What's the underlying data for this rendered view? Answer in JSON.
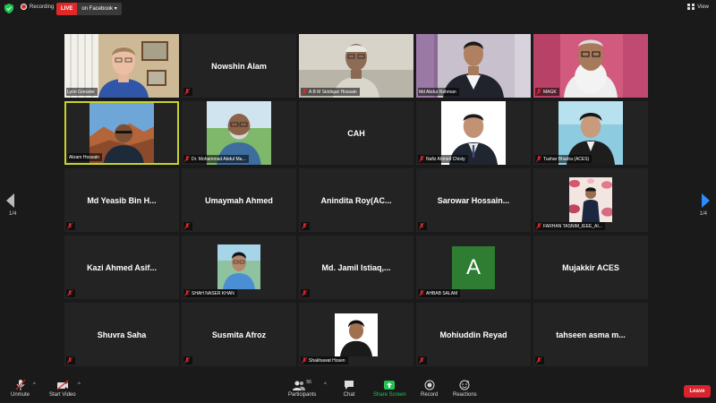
{
  "topbar": {
    "recording_label": "Recording",
    "live_label": "LIVE",
    "live_destination": "on Facebook",
    "view_label": "View"
  },
  "tiles": [
    {
      "name": "Lynn Gressler",
      "label": "Lynn Gressler",
      "show_name": false
    },
    {
      "name": "Nowshin Alam",
      "label": "",
      "show_name": true
    },
    {
      "name": "A B M Siddique Hossain",
      "label": "A B M Siddique Hossain",
      "show_name": false
    },
    {
      "name": "Md Abdur Rahman",
      "label": "Md Abdur Rahman",
      "show_name": false
    },
    {
      "name": "MAGK",
      "label": "MAGK",
      "show_name": false
    },
    {
      "name": "Akram Hossain",
      "label": "Akram Hossain",
      "show_name": false
    },
    {
      "name": "Dr. Mohammad Abdul Ma...",
      "label": "Dr. Mohammad Abdul Ma...",
      "show_name": false
    },
    {
      "name": "CAH",
      "label": "",
      "show_name": true
    },
    {
      "name": "Nafiz Ahmed Chisty",
      "label": "Nafiz Ahmed Chisty",
      "show_name": false
    },
    {
      "name": "Tushar Bhadra (ACES)",
      "label": "Tushar Bhadra (ACES)",
      "show_name": false
    },
    {
      "name": "Md Yeasib Bin H...",
      "label": "",
      "show_name": true
    },
    {
      "name": "Umaymah Ahmed",
      "label": "",
      "show_name": true
    },
    {
      "name": "Anindita Roy(AC...",
      "label": "",
      "show_name": true
    },
    {
      "name": "Sarowar Hossain...",
      "label": "",
      "show_name": true
    },
    {
      "name": "FARHAN TASNIM_IEEE_AI...",
      "label": "FARHAN TASNIM_IEEE_AI...",
      "show_name": false
    },
    {
      "name": "Kazi Ahmed Asif...",
      "label": "",
      "show_name": true
    },
    {
      "name": "SHAH NASER KHAN",
      "label": "SHAH NASER KHAN",
      "show_name": false
    },
    {
      "name": "Md. Jamil Istiaq,...",
      "label": "",
      "show_name": true
    },
    {
      "name": "AHBAB SALAM",
      "label": "AHBAB SALAM",
      "show_name": false,
      "avatar_letter": "A"
    },
    {
      "name": "Mujakkir ACES",
      "label": "",
      "show_name": true
    },
    {
      "name": "Shuvra Saha",
      "label": "",
      "show_name": true
    },
    {
      "name": "Susmita Afroz",
      "label": "",
      "show_name": true
    },
    {
      "name": "Shakhawat Hosen",
      "label": "Shakhawat Hosen",
      "show_name": false
    },
    {
      "name": "Mohiuddin Reyad",
      "label": "",
      "show_name": true
    },
    {
      "name": "tahseen asma m...",
      "label": "",
      "show_name": true
    }
  ],
  "pagination": {
    "left": "1/4",
    "right": "1/4"
  },
  "toolbar": {
    "unmute": "Unmute",
    "start_video": "Start Video",
    "participants": "Participants",
    "participants_count": "56",
    "chat": "Chat",
    "share_screen": "Share Screen",
    "record": "Record",
    "reactions": "Reactions",
    "leave": "Leave"
  },
  "colors": {
    "active_speaker_border": "#c8d42a",
    "live_red": "#e02828",
    "share_green": "#23c552",
    "avatar_green": "#2e7d32",
    "leave_red": "#d9232d",
    "nav_arrow_blue": "#2d8cff"
  },
  "icons": {
    "security": "shield-icon",
    "recording": "record-dot-icon",
    "muted": "muted-mic-icon",
    "nav_prev": "chevron-left-icon",
    "nav_next": "chevron-right-icon"
  }
}
